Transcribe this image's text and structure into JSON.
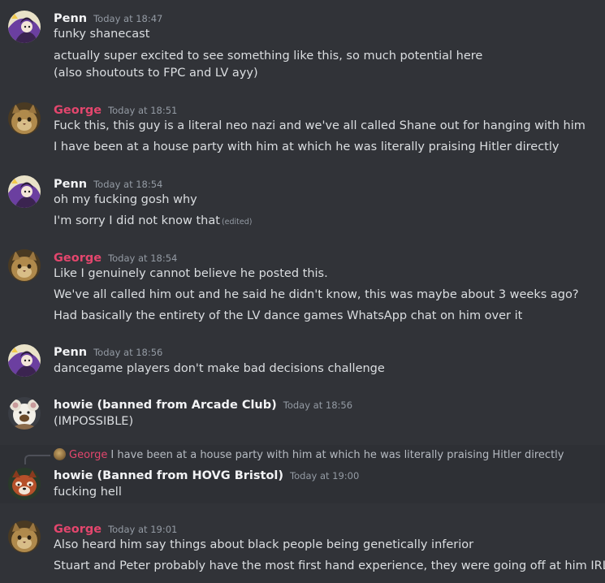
{
  "messages": [
    {
      "author": "Penn",
      "timestamp": "Today at 18:47",
      "lines": [
        "funky shanecast",
        "actually super excited to see something like this, so much potential here",
        "(also shoutouts to FPC and LV ayy)"
      ]
    },
    {
      "author": "George",
      "timestamp": "Today at 18:51",
      "lines": [
        "Fuck this, this guy is a literal neo nazi and we've all called Shane out for hanging with him",
        "I have been at a house party with him at which he was literally praising Hitler directly"
      ]
    },
    {
      "author": "Penn",
      "timestamp": "Today at 18:54",
      "lines": [
        "oh my fucking gosh why",
        "I'm sorry I did not know that"
      ],
      "edited_label": "(edited)"
    },
    {
      "author": "George",
      "timestamp": "Today at 18:54",
      "lines": [
        "Like I genuinely cannot believe he posted this.",
        "We've all called him out and he said he didn't know, this was maybe about 3 weeks ago?",
        "Had basically the entirety of the LV dance games WhatsApp chat on him over it"
      ]
    },
    {
      "author": "Penn",
      "timestamp": "Today at 18:56",
      "lines": [
        "dancegame players don't make bad decisions challenge"
      ]
    },
    {
      "author": "howie (banned from Arcade Club)",
      "timestamp": "Today at 18:56",
      "lines": [
        "(IMPOSSIBLE)"
      ]
    },
    {
      "author": "howie (Banned from HOVG Bristol)",
      "timestamp": "Today at 19:00",
      "lines": [
        "fucking hell"
      ],
      "reply": {
        "author": "George",
        "text": "I have been at a house party with him at which he was literally praising Hitler directly"
      }
    },
    {
      "author": "George",
      "timestamp": "Today at 19:01",
      "lines": [
        "Also heard him say things about black people being genetically inferior",
        "Stuart and Peter probably have the most first hand experience, they were going off at him IRL"
      ]
    }
  ],
  "icons": {
    "penn_avatar": "purple-character-avatar",
    "george_avatar": "cat-avatar",
    "howie1_avatar": "cartoon-mascot-avatar",
    "howie2_avatar": "red-panda-avatar"
  },
  "colors": {
    "background": "#313338",
    "highlight": "#2e3035",
    "george_name": "#e3466d",
    "text": "#dbdee1",
    "muted": "#949ba4"
  }
}
